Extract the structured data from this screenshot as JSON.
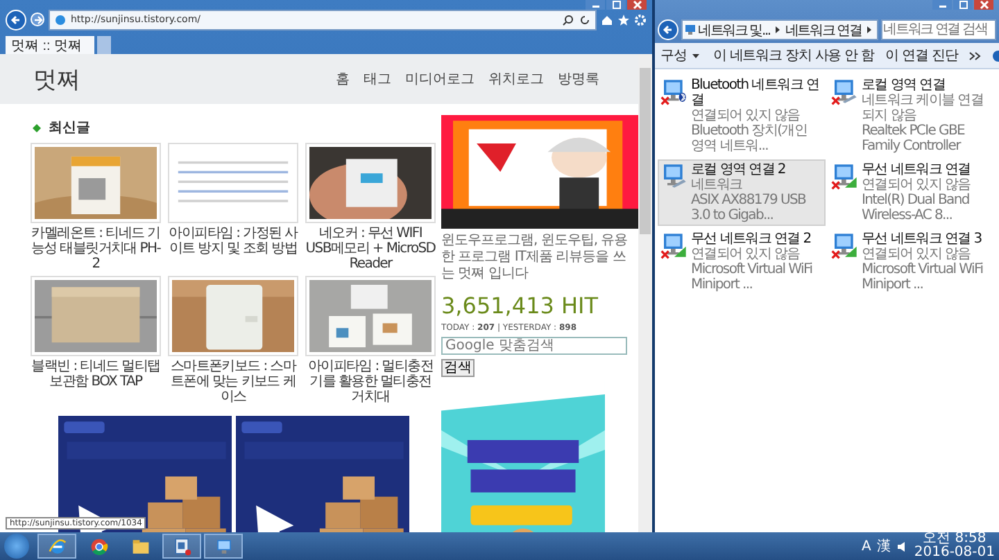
{
  "browser": {
    "address": "http://sunjinsu.tistory.com/",
    "tab": {
      "title": "멋쪄 :: 멋쪄",
      "selected": true
    },
    "status_url": "http://sunjinsu.tistory.com/1034"
  },
  "blog": {
    "title": "멋쪄",
    "nav": [
      "홈",
      "태그",
      "미디어로그",
      "위치로그",
      "방명록"
    ],
    "section_title": "최신글",
    "posts": [
      {
        "caption": "카멜레온트 : 티네드 기능성 태블릿거치대 PH-2"
      },
      {
        "caption": "아이피타임 : 가정된 사이트 방지 및 조회 방법"
      },
      {
        "caption": "네오커 : 무선 WIFI USB메모리 + MicroSD Reader"
      },
      {
        "caption": "블랙빈 : 티네드 멀티탭 보관함 BOX TAP"
      },
      {
        "caption": "스마트폰키보드 : 스마트폰에 맞는 키보드 케이스"
      },
      {
        "caption": "아이피타임 : 멀티충전기를 활용한 멀티충전 거치대"
      }
    ],
    "ads": [
      {
        "kind": "picture"
      },
      {
        "kind": "picture"
      }
    ]
  },
  "sidebar": {
    "description": "윈도우프로그램, 윈도우팁, 유용한 프로그램 IT제품 리뷰등을 쓰는 멋쪄 입니다",
    "hits": "3,651,413 HIT",
    "visits": "TODAY : **207** | YESTERDAY : **898**",
    "search_placeholder": "Google 맞춤검색",
    "search_button": "검색"
  },
  "explorer": {
    "breadcrumb": [
      "네트워크 및...",
      "네트워크 연결"
    ],
    "search_placeholder": "네트워크 연결 검색",
    "toolbar": [
      "구성",
      "이 네트워크 장치 사용 안 함",
      "이 연결 진단"
    ],
    "connections": [
      {
        "name": "Bluetooth 네트워크 연결",
        "status": "연결되어 있지 않음",
        "device": "Bluetooth 장치(개인 영역 네트워...",
        "kind": "bluetooth",
        "connected": false,
        "selected": false
      },
      {
        "name": "로컬 영역 연결",
        "status": "네트워크 케이블 연결되지 않음",
        "device": "Realtek PCIe GBE Family Controller",
        "kind": "wired",
        "connected": false,
        "selected": false
      },
      {
        "name": "로컬 영역 연결 2",
        "status": "네트워크",
        "device": "ASIX AX88179 USB 3.0 to Gigab...",
        "kind": "wired",
        "connected": true,
        "selected": true
      },
      {
        "name": "무선 네트워크 연결",
        "status": "연결되어 있지 않음",
        "device": "Intel(R) Dual Band Wireless-AC 8...",
        "kind": "wireless",
        "connected": false,
        "selected": false
      },
      {
        "name": "무선 네트워크 연결 2",
        "status": "연결되어 있지 않음",
        "device": "Microsoft Virtual WiFi Miniport ...",
        "kind": "wireless",
        "connected": false,
        "selected": false
      },
      {
        "name": "무선 네트워크 연결 3",
        "status": "연결되어 있지 않음",
        "device": "Microsoft Virtual WiFi Miniport ...",
        "kind": "wireless",
        "connected": false,
        "selected": false
      }
    ]
  },
  "taskbar": {
    "apps": [
      {
        "kind": "ie",
        "running": true
      },
      {
        "kind": "chrome",
        "running": false
      },
      {
        "kind": "folder",
        "running": false
      },
      {
        "kind": "tool",
        "running": true
      },
      {
        "kind": "network",
        "running": true
      }
    ],
    "ime": [
      "A",
      "漢"
    ],
    "time": "오전 8:58",
    "date": "2016-08-01"
  }
}
